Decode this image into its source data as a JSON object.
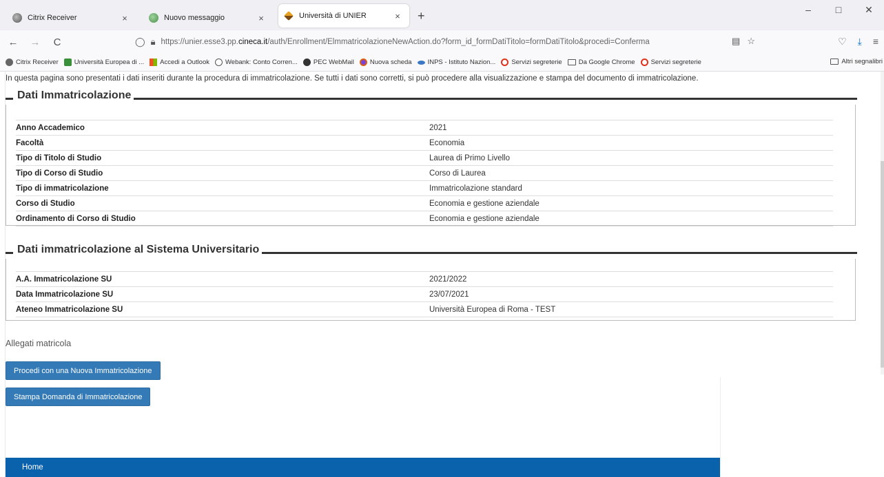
{
  "tabs": [
    {
      "title": "Citrix Receiver",
      "icon": "citrix-icon",
      "active": false
    },
    {
      "title": "Nuovo messaggio",
      "icon": "mail-icon",
      "active": false
    },
    {
      "title": "Università di UNIER",
      "icon": "unier-icon",
      "active": true
    }
  ],
  "tab_close": "×",
  "new_tab": "+",
  "window_controls": {
    "minimize": "–",
    "maximize": "□",
    "close": "✕"
  },
  "nav": {
    "back": "←",
    "forward": "→",
    "reload": "C"
  },
  "url": {
    "prefix": "https://unier.esse3.pp.",
    "domain": "cineca.it",
    "suffix": "/auth/Enrollment/ElmmatricolazioneNewAction.do?form_id_formDatiTitolo=formDatiTitolo&procedi=Conferma"
  },
  "bookmarks": [
    {
      "label": "Citrix Receiver",
      "icon": "citrix-icon",
      "color": "#666666"
    },
    {
      "label": "Università Europea di ...",
      "icon": "unier-icon",
      "color": "#3a8f3a"
    },
    {
      "label": "Accedi a Outlook",
      "icon": "outlook-icon",
      "color": "#f25022"
    },
    {
      "label": "Webank: Conto Corren...",
      "icon": "globe-icon",
      "color": "#555555"
    },
    {
      "label": "PEC WebMail",
      "icon": "pec-icon",
      "color": "#333333"
    },
    {
      "label": "Nuova scheda",
      "icon": "firefox-icon",
      "color": "#e66000"
    },
    {
      "label": "INPS - Istituto Nazion...",
      "icon": "inps-icon",
      "color": "#3b77c2"
    },
    {
      "label": "Servizi segreterie",
      "icon": "opera-icon",
      "color": "#e0311d"
    },
    {
      "label": "Da Google Chrome",
      "icon": "folder-icon",
      "color": "#555555"
    },
    {
      "label": "Servizi segreterie",
      "icon": "opera-icon",
      "color": "#e0311d"
    }
  ],
  "bookmarks_other": "Altri segnalibri",
  "intro": "In questa pagina sono presentati i dati inseriti durante la procedura di immatricolazione. Se tutti i dati sono corretti, si può procedere alla visualizzazione e stampa del documento di immatricolazione.",
  "section1": {
    "title": "Dati Immatricolazione",
    "rows": [
      {
        "key": "Anno Accademico",
        "value": "2021"
      },
      {
        "key": "Facoltà",
        "value": "Economia"
      },
      {
        "key": "Tipo di Titolo di Studio",
        "value": "Laurea di Primo Livello"
      },
      {
        "key": "Tipo di Corso di Studio",
        "value": "Corso di Laurea"
      },
      {
        "key": "Tipo di immatricolazione",
        "value": "Immatricolazione standard"
      },
      {
        "key": "Corso di Studio",
        "value": "Economia e gestione aziendale"
      },
      {
        "key": "Ordinamento di Corso di Studio",
        "value": "Economia e gestione aziendale"
      }
    ]
  },
  "section2": {
    "title": "Dati immatricolazione al Sistema Universitario",
    "rows": [
      {
        "key": "A.A. Immatricolazione SU",
        "value": "2021/2022"
      },
      {
        "key": "Data Immatricolazione SU",
        "value": "23/07/2021"
      },
      {
        "key": "Ateneo Immatricolazione SU",
        "value": "Università Europea di Roma - TEST"
      }
    ]
  },
  "allegati": "Allegati matricola",
  "buttons": {
    "new_enrollment": "Procedi con una Nuova Immatricolazione",
    "print_request": "Stampa Domanda di Immatricolazione"
  },
  "footer": {
    "home": "Home"
  },
  "colors": {
    "primary_button": "#337ab7",
    "footer": "#0a62ad"
  }
}
